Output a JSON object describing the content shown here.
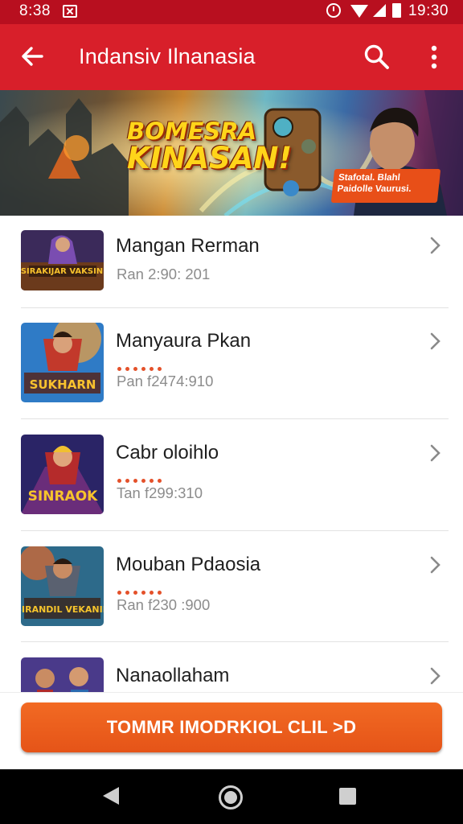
{
  "status_bar": {
    "time": "8:38",
    "clock": "19:30",
    "icons": [
      "notification-icon",
      "alarm-icon",
      "wifi-icon",
      "signal-icon",
      "battery-icon"
    ]
  },
  "app_bar": {
    "title": "Indansiv Ilnanasia",
    "back_icon": "arrow-left-icon",
    "search_icon": "search-icon",
    "more_icon": "more-vertical-icon",
    "color": "#d81f2a"
  },
  "banner": {
    "headline_line1": "BOMESRA",
    "headline_line2": "KINASAN!",
    "promo_line1": "Stafotal. Blahl",
    "promo_line2": "Paidolle Vaurusi."
  },
  "games": [
    {
      "name": "Mangan Rerman",
      "subtitle": "Ran 2:90: 201",
      "rating_dots": 0,
      "thumb_text": "SIRAKIJAR VAKSIN"
    },
    {
      "name": "Manyaura Pkan",
      "subtitle": "Pan f2474:910",
      "rating_dots": 6,
      "thumb_text": "SUKHARN"
    },
    {
      "name": "Cabr oloihlo",
      "subtitle": "Tan f299:310",
      "rating_dots": 6,
      "thumb_text": "SINRAOK"
    },
    {
      "name": "Mouban Pdaosia",
      "subtitle": "Ran f230 :900",
      "rating_dots": 6,
      "thumb_text": "SIRANDIL VEKANIN"
    },
    {
      "name": "Nanaollaham",
      "subtitle": "",
      "rating_dots": 0,
      "thumb_text": ""
    }
  ],
  "cta": {
    "label": "TOMMR IMODRKIOL CLIL >D",
    "color": "#f0621f"
  },
  "nav": {
    "back_icon": "nav-back-icon",
    "home_icon": "nav-home-icon",
    "recents_icon": "nav-recents-icon"
  }
}
